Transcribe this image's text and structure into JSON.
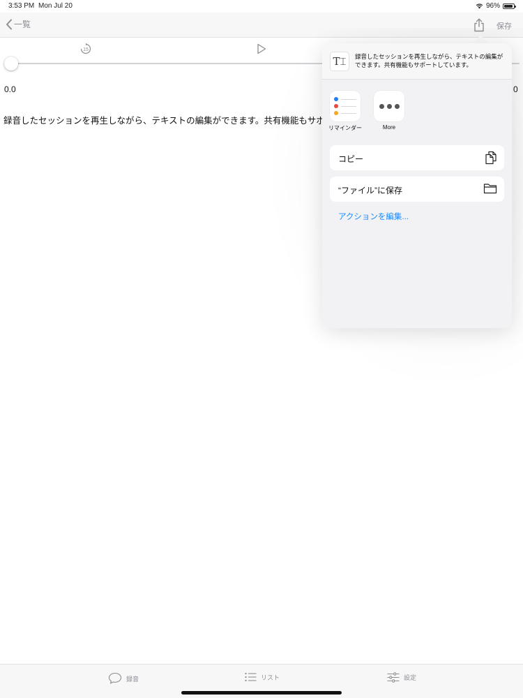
{
  "status_bar": {
    "time": "3:53 PM",
    "date": "Mon Jul 20",
    "battery": "96%",
    "battery_level": 0.96
  },
  "nav": {
    "back_label": "一覧",
    "save_label": "保存",
    "back_icon": "chevron-left-icon",
    "share_icon": "share-icon"
  },
  "player": {
    "skip_icon": "skip-back-15-icon",
    "skip_seconds": "15",
    "play_icon": "play-icon",
    "position": 0.0,
    "time_start": "0.0",
    "time_end": "0"
  },
  "body_text": "録音したセッションを再生しながら、テキストの編集ができます。共有機能もサポートしています。",
  "share_sheet": {
    "preview_text": "録音したセッションを再生しながら、テキストの編集ができます。共有機能もサポートしています。",
    "apps": [
      {
        "label": "リマインダー",
        "icon": "reminders-icon"
      },
      {
        "label": "More",
        "icon": "more-icon"
      }
    ],
    "actions": [
      {
        "label": "コピー",
        "icon": "copy-icon"
      },
      {
        "label": "“ファイル”に保存",
        "icon": "folder-icon"
      }
    ],
    "edit_actions": "アクションを編集...",
    "link_color": "#1a8cff"
  },
  "tab_bar": {
    "tabs": [
      {
        "label": "録音",
        "icon": "speech-bubble-icon"
      },
      {
        "label": "リスト",
        "icon": "list-icon"
      },
      {
        "label": "設定",
        "icon": "sliders-icon"
      }
    ]
  }
}
